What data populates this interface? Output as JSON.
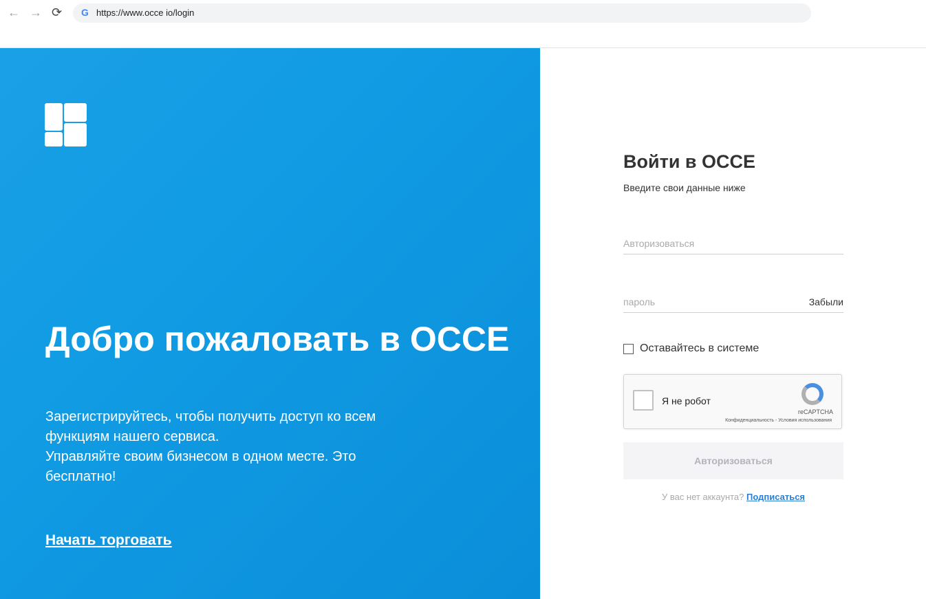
{
  "browser": {
    "url": "https://www.occe io/login",
    "back_icon": "←",
    "forward_icon": "→",
    "reload_icon": "⟳",
    "site_icon": "G"
  },
  "hero": {
    "title": "Добро пожаловать в OCCE",
    "subtitle_lines": [
      "Зарегистрируйтесь, чтобы получить доступ ко всем",
      "функциям нашего сервиса.",
      "Управляйте своим бизнесом в одном месте. Это",
      "бесплатно!"
    ],
    "cta": "Начать торговать"
  },
  "form": {
    "title": "Войти в OCCE",
    "hint": "Введите свои данные ниже",
    "login_placeholder": "Авторизоваться",
    "password_placeholder": "пароль",
    "forgot": "Забыли",
    "remember": "Оставайтесь в системе",
    "captcha": {
      "label": "Я не робот",
      "brand": "reCAPTCHA",
      "links": "Конфиденциальность - Условия использования"
    },
    "submit": "Авторизоваться",
    "no_account": "У вас нет аккаунта?",
    "signup": "Подписаться"
  }
}
